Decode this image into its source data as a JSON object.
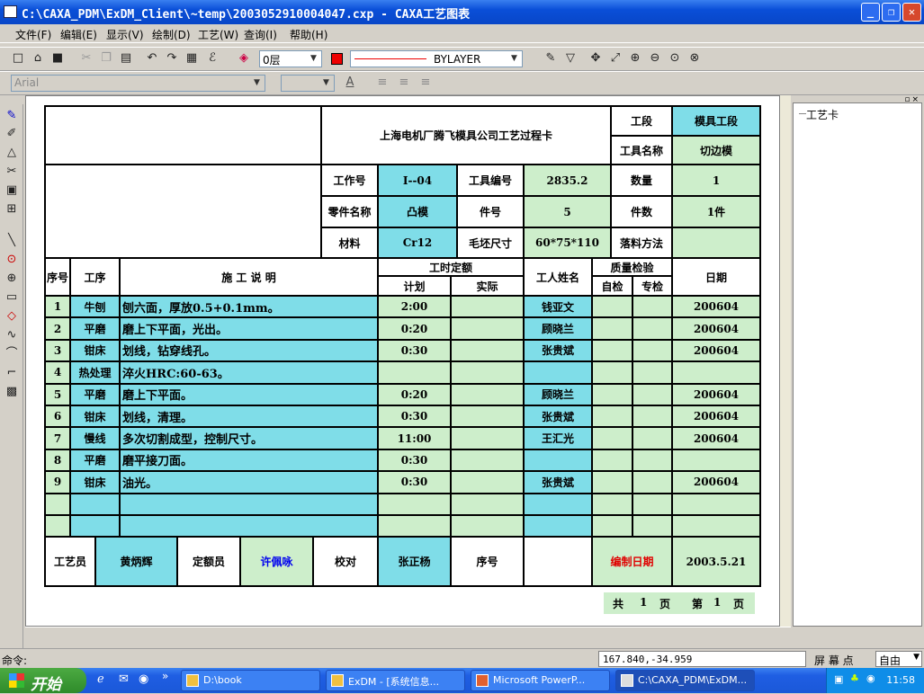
{
  "window": {
    "title": "C:\\CAXA_PDM\\ExDM_Client\\~temp\\2003052910004047.cxp - CAXA工艺图表",
    "min": "_",
    "max": "❐",
    "close": "✕"
  },
  "menu": [
    "文件(F)",
    "编辑(E)",
    "显示(V)",
    "绘制(D)",
    "工艺(W)",
    "查询(I)",
    "帮助(H)"
  ],
  "toolbar": {
    "layer": "0层",
    "linetype": "BYLAYER",
    "font": "Arial",
    "font_size": "",
    "layer_color": "#ee0000"
  },
  "panel": {
    "title": "工艺卡",
    "controls": "▫×"
  },
  "status": {
    "cmd_label": "命令:",
    "coords": "167.840,-34.959",
    "snap_label": "屏 幕 点",
    "snap_mode": "自由"
  },
  "taskbar": {
    "start": "开始",
    "quick": "»",
    "tasks": [
      "D:\\book",
      "ExDM - [系统信息...",
      "Microsoft PowerP...",
      "C:\\CAXA_PDM\\ExDM..."
    ],
    "clock": "11:58"
  },
  "card": {
    "company": "上海电机厂腾飞模具公司工艺过程卡",
    "labels": {
      "gongduan": "工段",
      "tool_name": "工具名称",
      "job_no": "工作号",
      "tool_no": "工具编号",
      "qty": "数量",
      "part_name": "零件名称",
      "item_no": "件号",
      "pieces": "件数",
      "material": "材料",
      "blank_size": "毛坯尺寸",
      "cut_method": "落料方法",
      "seq": "序号",
      "proc": "工序",
      "desc": "施    工    说    明",
      "std_time": "工时定额",
      "plan": "计划",
      "actual": "实际",
      "worker": "工人姓名",
      "qc": "质量检验",
      "self_check": "自检",
      "special_check": "专检",
      "date": "日期"
    },
    "values": {
      "gongduan": "模具工段",
      "tool_name": "切边模",
      "job_no": "I--04",
      "tool_no": "2835.2",
      "qty": "1",
      "part_name": "凸模",
      "item_no": "5",
      "pieces": "1件",
      "material": "Cr12",
      "blank_size": "60*75*110",
      "cut_method": ""
    },
    "rows": [
      {
        "seq": "1",
        "proc": "牛刨",
        "desc": "刨六面，厚放0.5+0.1mm。",
        "plan": "2:00",
        "worker": "钱亚文",
        "date": "200604"
      },
      {
        "seq": "2",
        "proc": "平磨",
        "desc": "磨上下平面，光出。",
        "plan": "0:20",
        "worker": "顾晓兰",
        "date": "200604"
      },
      {
        "seq": "3",
        "proc": "钳床",
        "desc": "划线，钻穿线孔。",
        "plan": "0:30",
        "worker": "张贵斌",
        "date": "200604"
      },
      {
        "seq": "4",
        "proc": "热处理",
        "desc": "淬火HRC:60-63。",
        "plan": "",
        "worker": "",
        "date": ""
      },
      {
        "seq": "5",
        "proc": "平磨",
        "desc": "磨上下平面。",
        "plan": "0:20",
        "worker": "顾晓兰",
        "date": "200604"
      },
      {
        "seq": "6",
        "proc": "钳床",
        "desc": "划线，清理。",
        "plan": "0:30",
        "worker": "张贵斌",
        "date": "200604"
      },
      {
        "seq": "7",
        "proc": "慢线",
        "desc": "多次切割成型，控制尺寸。",
        "plan": "11:00",
        "worker": "王汇光",
        "date": "200604"
      },
      {
        "seq": "8",
        "proc": "平磨",
        "desc": "磨平接刀面。",
        "plan": "0:30",
        "worker": "",
        "date": ""
      },
      {
        "seq": "9",
        "proc": "钳床",
        "desc": "油光。",
        "plan": "0:30",
        "worker": "张贵斌",
        "date": "200604"
      },
      {
        "seq": "",
        "proc": "",
        "desc": "",
        "plan": "",
        "worker": "",
        "date": ""
      },
      {
        "seq": "",
        "proc": "",
        "desc": "",
        "plan": "",
        "worker": "",
        "date": ""
      }
    ],
    "bottom": {
      "craftsman_label": "工艺员",
      "craftsman": "黄炳辉",
      "quota_label": "定额员",
      "quota": "许佩咏",
      "check_label": "校对",
      "check": "张正杨",
      "seq_label": "序号",
      "seq": "",
      "date_label": "编制日期",
      "date": "2003.5.21"
    },
    "footer": {
      "total": "共",
      "total_n": "1",
      "page_unit": "页",
      "page": "第",
      "page_n": "1",
      "page_unit2": "页"
    }
  }
}
